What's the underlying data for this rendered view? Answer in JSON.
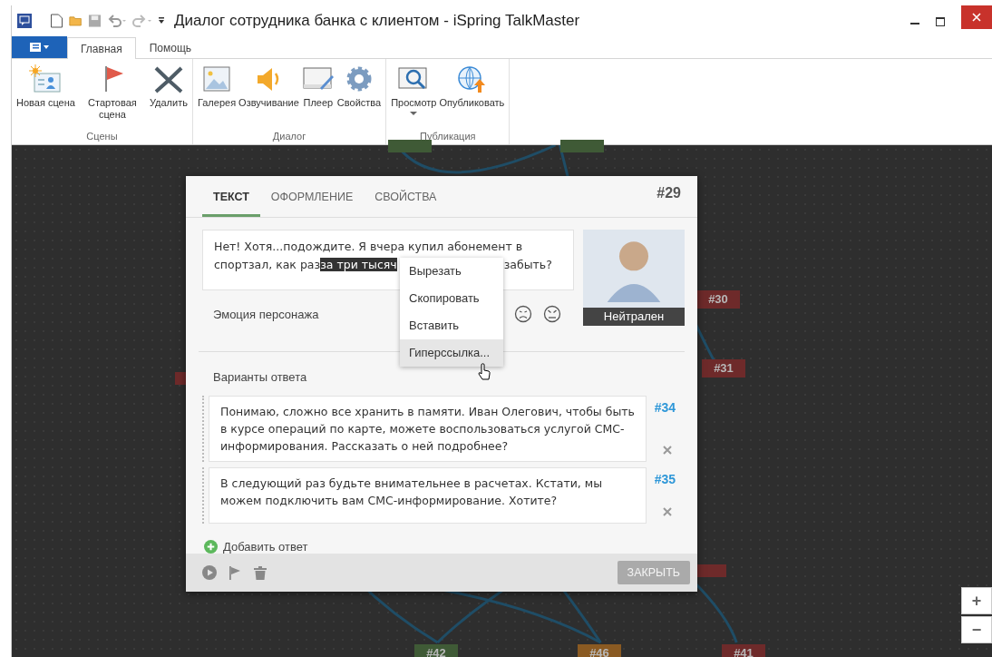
{
  "window": {
    "title": "Диалог сотрудника банка с клиентом - iSpring TalkMaster"
  },
  "ribbon_tabs": [
    {
      "label": "Главная",
      "selected": true
    },
    {
      "label": "Помощь",
      "selected": false
    }
  ],
  "ribbon_groups": [
    {
      "label": "Сцены",
      "buttons": [
        {
          "kind": "new",
          "label": "Новая сцена",
          "dropdown": false
        },
        {
          "kind": "flag",
          "label": "Стартовая сцена",
          "dropdown": false
        },
        {
          "kind": "delete",
          "label": "Удалить",
          "dropdown": false
        }
      ]
    },
    {
      "label": "Диалог",
      "buttons": [
        {
          "kind": "gallery",
          "label": "Галерея",
          "dropdown": false
        },
        {
          "kind": "audio",
          "label": "Озвучивание",
          "dropdown": false
        },
        {
          "kind": "player",
          "label": "Плеер",
          "dropdown": false
        },
        {
          "kind": "settings",
          "label": "Свойства",
          "dropdown": false
        }
      ]
    },
    {
      "label": "Публикация",
      "buttons": [
        {
          "kind": "preview",
          "label": "Просмотр",
          "dropdown": true
        },
        {
          "kind": "publish",
          "label": "Опубликовать",
          "dropdown": false
        }
      ]
    }
  ],
  "canvas": {
    "nodes": [
      {
        "label": "#30",
        "color": "#6e2a2a"
      },
      {
        "label": "#31",
        "color": "#6e2a2a"
      },
      {
        "label": "#42",
        "color": "#3f5a36"
      },
      {
        "label": "#46",
        "color": "#8a5a22"
      },
      {
        "label": "#41",
        "color": "#6e2a2a"
      }
    ]
  },
  "dialog": {
    "tabs": [
      {
        "label": "ТЕКСТ",
        "selected": true
      },
      {
        "label": "ОФОРМЛЕНИЕ",
        "selected": false
      },
      {
        "label": "СВОЙСТВА",
        "selected": false
      }
    ],
    "scene_number": "#29",
    "replica": {
      "text_before": "Нет! Хотя...подождите. Я вчера купил абонемент в спортзал, как раз",
      "selection": "за три тысяч",
      "text_after": "забыть?"
    },
    "emotion_label": "Эмоция персонажа",
    "character_caption": "Нейтрален",
    "answers_label": "Варианты ответа",
    "answers": [
      {
        "text": "Понимаю, сложно все хранить в памяти. Иван Олегович, чтобы быть в курсе операций по карте, можете воспользоваться услугой СМС-информирования. Рассказать о ней подробнее?",
        "number": "#34"
      },
      {
        "text": "В следующий раз будьте внимательнее в расчетах. Кстати, мы можем подключить вам СМС-информирование. Хотите?",
        "number": "#35"
      }
    ],
    "add_answer": "Добавить ответ",
    "close_button": "ЗАКРЫТЬ"
  },
  "context_menu": [
    {
      "label": "Вырезать",
      "selected": false
    },
    {
      "label": "Скопировать",
      "selected": false
    },
    {
      "label": "Вставить",
      "selected": false
    },
    {
      "label": "Гиперссылка...",
      "selected": true
    }
  ],
  "zoom": {
    "plus": "+",
    "minus": "−"
  }
}
